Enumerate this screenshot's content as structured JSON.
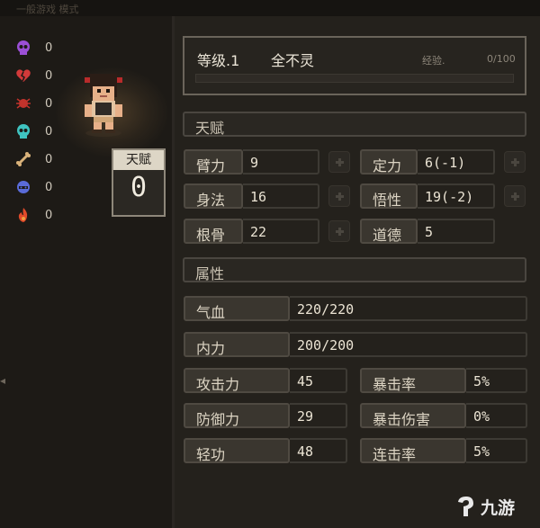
{
  "top_bar_text": "一般游戏   模式",
  "status_counts": [
    {
      "icon": "purple-skull-icon",
      "value": "0",
      "color": "#9b4fd6"
    },
    {
      "icon": "broken-heart-icon",
      "value": "0",
      "color": "#d23a3a"
    },
    {
      "icon": "red-spider-icon",
      "value": "0",
      "color": "#c2332c"
    },
    {
      "icon": "cyan-skull-icon",
      "value": "0",
      "color": "#3fc3c0"
    },
    {
      "icon": "bone-icon",
      "value": "0",
      "color": "#d9b27a"
    },
    {
      "icon": "blue-ghost-icon",
      "value": "0",
      "color": "#5a6bd8"
    },
    {
      "icon": "fire-icon",
      "value": "0",
      "color": "#e04a2a"
    }
  ],
  "talent_box": {
    "label": "天赋",
    "value": "0"
  },
  "header": {
    "level": "等级.1",
    "name": "全不灵",
    "exp_label": "经验.",
    "exp_value": "0/100",
    "exp_progress": 0
  },
  "sections": {
    "talent": "天赋",
    "attributes": "属性"
  },
  "talent_stats": [
    {
      "label": "臂力",
      "value": "9"
    },
    {
      "label": "定力",
      "value": "6(-1)"
    },
    {
      "label": "身法",
      "value": "16"
    },
    {
      "label": "悟性",
      "value": "19(-2)"
    },
    {
      "label": "根骨",
      "value": "22"
    },
    {
      "label": "道德",
      "value": "5"
    }
  ],
  "attributes_wide": [
    {
      "label": "气血",
      "value": "220/220"
    },
    {
      "label": "内力",
      "value": "200/200"
    }
  ],
  "attributes_pair": [
    {
      "label": "攻击力",
      "value": "45"
    },
    {
      "label": "暴击率",
      "value": "5%"
    },
    {
      "label": "防御力",
      "value": "29"
    },
    {
      "label": "暴击伤害",
      "value": "0%"
    },
    {
      "label": "轻功",
      "value": "48"
    },
    {
      "label": "连击率",
      "value": "5%"
    }
  ],
  "watermark": "九游",
  "colors": {
    "background": "#24211c",
    "panel_border": "#6a645a",
    "label_fill": "#3a362f",
    "accent": "#8b6f3d"
  }
}
